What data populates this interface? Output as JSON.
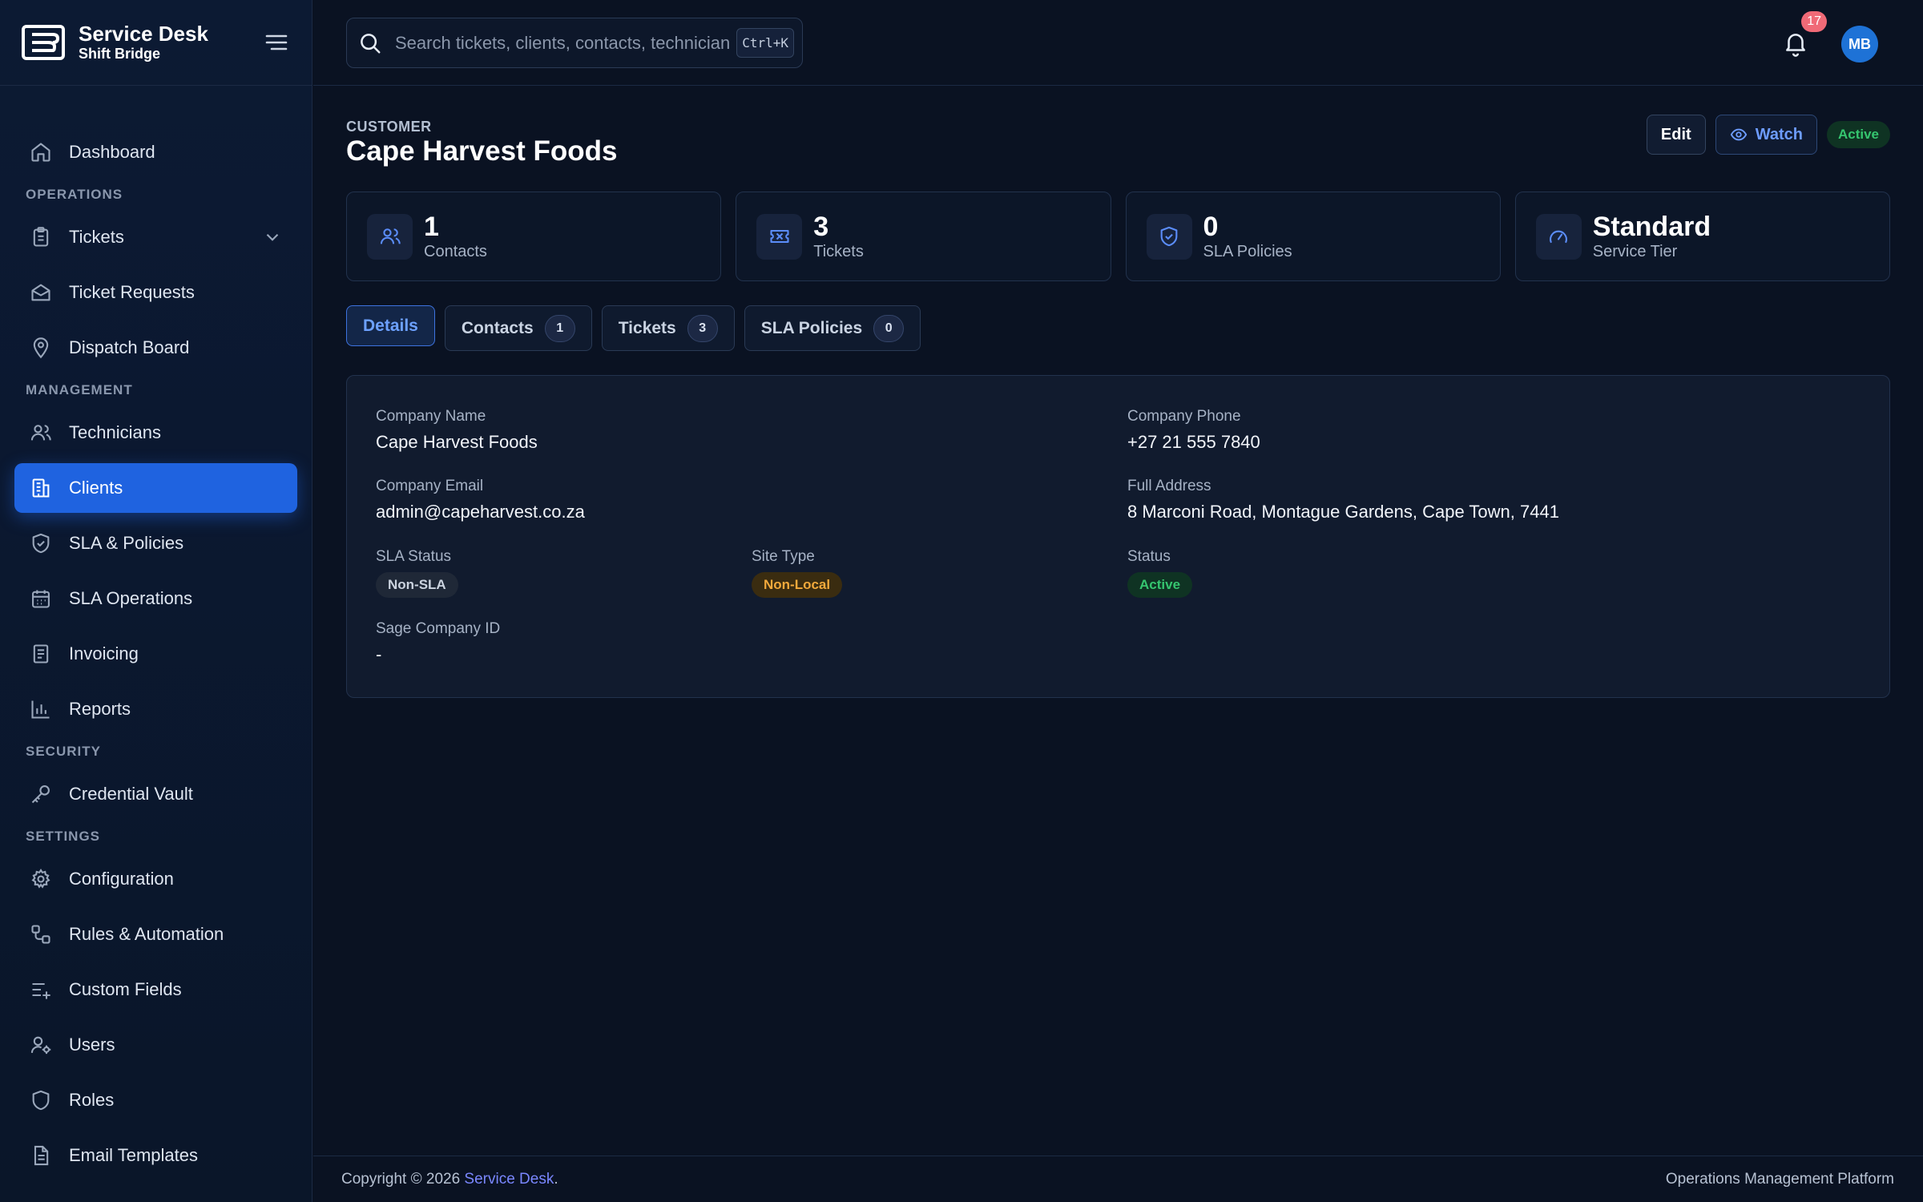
{
  "brand": {
    "title": "Service Desk",
    "subtitle": "Shift Bridge"
  },
  "search": {
    "placeholder": "Search tickets, clients, contacts, technician",
    "shortcut": "Ctrl+K"
  },
  "notifications": {
    "count": "17"
  },
  "user": {
    "initials": "MB"
  },
  "sidebar": {
    "dashboard": "Dashboard",
    "sections": {
      "operations": "OPERATIONS",
      "management": "MANAGEMENT",
      "security": "SECURITY",
      "settings": "SETTINGS"
    },
    "operations": [
      "Tickets",
      "Ticket Requests",
      "Dispatch Board"
    ],
    "management": [
      "Technicians",
      "Clients",
      "SLA & Policies",
      "SLA Operations",
      "Invoicing",
      "Reports"
    ],
    "security": [
      "Credential Vault"
    ],
    "settings": [
      "Configuration",
      "Rules & Automation",
      "Custom Fields",
      "Users",
      "Roles",
      "Email Templates"
    ],
    "active": "Clients"
  },
  "page": {
    "eyebrow": "CUSTOMER",
    "title": "Cape Harvest Foods",
    "actions": {
      "edit": "Edit",
      "watch": "Watch",
      "status": "Active"
    }
  },
  "stats": [
    {
      "value": "1",
      "label": "Contacts",
      "icon": "users-icon"
    },
    {
      "value": "3",
      "label": "Tickets",
      "icon": "ticket-icon"
    },
    {
      "value": "0",
      "label": "SLA Policies",
      "icon": "shield-check-icon"
    },
    {
      "value": "Standard",
      "label": "Service Tier",
      "icon": "gauge-icon"
    }
  ],
  "tabs": [
    {
      "label": "Details",
      "count": null
    },
    {
      "label": "Contacts",
      "count": "1"
    },
    {
      "label": "Tickets",
      "count": "3"
    },
    {
      "label": "SLA Policies",
      "count": "0"
    }
  ],
  "details": {
    "company_name": {
      "label": "Company Name",
      "value": "Cape Harvest Foods"
    },
    "company_phone": {
      "label": "Company Phone",
      "value": "+27 21 555 7840"
    },
    "company_email": {
      "label": "Company Email",
      "value": "admin@capeharvest.co.za"
    },
    "full_address": {
      "label": "Full Address",
      "value": "8 Marconi Road, Montague Gardens, Cape Town, 7441"
    },
    "sla_status": {
      "label": "SLA Status",
      "value": "Non-SLA"
    },
    "site_type": {
      "label": "Site Type",
      "value": "Non-Local"
    },
    "status": {
      "label": "Status",
      "value": "Active"
    },
    "sage_id": {
      "label": "Sage Company ID",
      "value": "-"
    }
  },
  "footer": {
    "copyright_prefix": "Copyright © 2026 ",
    "brand_link": "Service Desk",
    "copyright_suffix": ".",
    "tagline": "Operations Management Platform"
  },
  "colors": {
    "accent": "#1f63e0",
    "success": "#35c56f",
    "warning": "#f2a93b",
    "badge": "#f06a77"
  }
}
